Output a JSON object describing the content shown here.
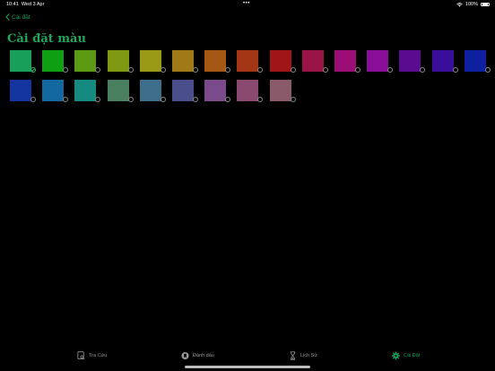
{
  "status": {
    "time": "10:41",
    "date": "Wed 3 Apr",
    "battery": "100%"
  },
  "nav": {
    "back_label": "Cài đặt"
  },
  "page": {
    "title": "Cài đặt màu"
  },
  "colors": {
    "row1": [
      "#17a05a",
      "#0ea012",
      "#5c9a14",
      "#7f9a12",
      "#9a9a16",
      "#a07a16",
      "#a55714",
      "#a33614",
      "#a01616",
      "#9a1448",
      "#9a0e76",
      "#8a0e9a",
      "#5a0c90",
      "#3a0e9a",
      "#0e1fa0"
    ],
    "row2": [
      "#1434a0",
      "#1468a0",
      "#148a80",
      "#4a8060",
      "#3e6e8a",
      "#4a4e8a",
      "#7a4a8a",
      "#8a4a70",
      "#8a5a6a"
    ],
    "selected_index": 0,
    "accent": "#1db462"
  },
  "tabbar": {
    "items": [
      {
        "label": "Tra Cứu",
        "icon": "search-book-icon"
      },
      {
        "label": "Đánh dấu",
        "icon": "bookmark-icon"
      },
      {
        "label": "Lịch Sử",
        "icon": "hourglass-icon"
      },
      {
        "label": "Cài Đặt",
        "icon": "gear-icon"
      }
    ],
    "active_index": 3
  }
}
